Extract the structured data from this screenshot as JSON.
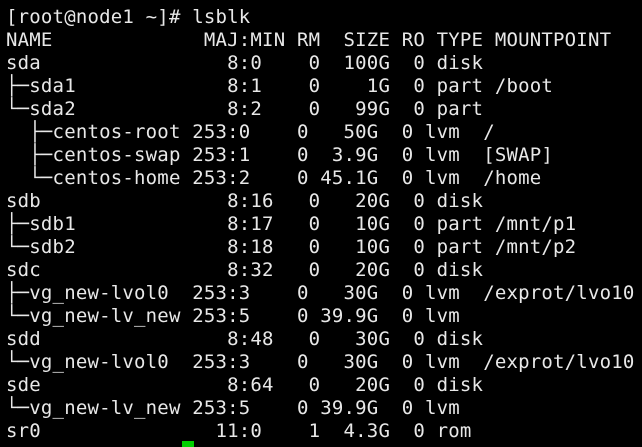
{
  "terminal": {
    "prompt": "[root@node1 ~]# lsblk",
    "header": "NAME             MAJ:MIN RM  SIZE RO TYPE MOUNTPOINT",
    "lines": [
      "sda                8:0    0  100G  0 disk",
      "├─sda1             8:1    0    1G  0 part /boot",
      "└─sda2             8:2    0   99G  0 part",
      "  ├─centos-root 253:0    0   50G  0 lvm  /",
      "  ├─centos-swap 253:1    0  3.9G  0 lvm  [SWAP]",
      "  └─centos-home 253:2    0 45.1G  0 lvm  /home",
      "sdb                8:16   0   20G  0 disk",
      "├─sdb1             8:17   0   10G  0 part /mnt/p1",
      "└─sdb2             8:18   0   10G  0 part /mnt/p2",
      "sdc                8:32   0   20G  0 disk",
      "├─vg_new-lvol0  253:3    0   30G  0 lvm  /exprot/lvo10",
      "└─vg_new-lv_new 253:5    0 39.9G  0 lvm",
      "sdd                8:48   0   30G  0 disk",
      "└─vg_new-lvol0  253:3    0   30G  0 lvm  /exprot/lvo10",
      "sde                8:64   0   20G  0 disk",
      "└─vg_new-lv_new 253:5    0 39.9G  0 lvm",
      "sr0               11:0    1  4.3G  0 rom"
    ],
    "cursor_color": "#00d000"
  }
}
